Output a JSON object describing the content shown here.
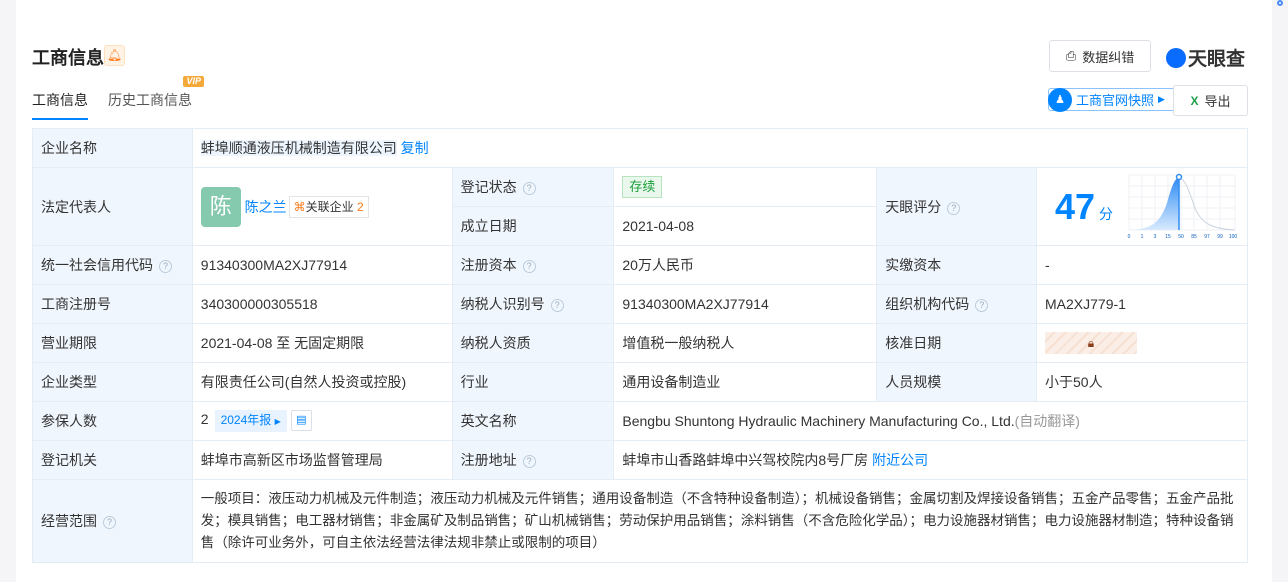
{
  "header": {
    "title": "工商信息",
    "correct_button": "数据纠错",
    "brand": "天眼查",
    "snapshot_button": "工商官网快照",
    "export_button": "导出"
  },
  "tabs": [
    {
      "label": "工商信息",
      "active": true
    },
    {
      "label": "历史工商信息",
      "badge": "VIP"
    }
  ],
  "rows": {
    "company_name": {
      "label": "企业名称",
      "value": "蚌埠顺通液压机械制造有限公司",
      "copy": "复制"
    },
    "legal_rep": {
      "label": "法定代表人",
      "avatar": "陈",
      "name": "陈之兰",
      "related_label": "关联企业",
      "related_count": "2"
    },
    "reg_status": {
      "label": "登记状态",
      "value": "存续",
      "color": "#1a9f3a"
    },
    "founded": {
      "label": "成立日期",
      "value": "2021-04-08"
    },
    "score": {
      "label": "天眼评分",
      "value": "47",
      "unit": "分",
      "ticks": [
        "0",
        "1",
        "3",
        "15",
        "50",
        "85",
        "97",
        "99",
        "100"
      ]
    },
    "credit_code": {
      "label": "统一社会信用代码",
      "value": "91340300MA2XJ77914"
    },
    "reg_capital": {
      "label": "注册资本",
      "value": "20万人民币"
    },
    "paid_capital": {
      "label": "实缴资本",
      "value": "-"
    },
    "reg_no": {
      "label": "工商注册号",
      "value": "340300000305518"
    },
    "tax_id": {
      "label": "纳税人识别号",
      "value": "91340300MA2XJ77914"
    },
    "org_code": {
      "label": "组织机构代码",
      "value": "MA2XJ779-1"
    },
    "term": {
      "label": "营业期限",
      "value": "2021-04-08 至 无固定期限"
    },
    "taxpayer_qual": {
      "label": "纳税人资质",
      "value": "增值税一般纳税人"
    },
    "approval_date": {
      "label": "核准日期"
    },
    "company_type": {
      "label": "企业类型",
      "value": "有限责任公司(自然人投资或控股)"
    },
    "industry": {
      "label": "行业",
      "value": "通用设备制造业"
    },
    "staff_size": {
      "label": "人员规模",
      "value": "小于50人"
    },
    "insured": {
      "label": "参保人数",
      "value": "2",
      "report": "2024年报"
    },
    "english_name": {
      "label": "英文名称",
      "value": "Bengbu Shuntong Hydraulic Machinery Manufacturing Co., Ltd.",
      "note": "(自动翻译)"
    },
    "authority": {
      "label": "登记机关",
      "value": "蚌埠市高新区市场监督管理局"
    },
    "address": {
      "label": "注册地址",
      "value": "蚌埠市山香路蚌埠中兴驾校院内8号厂房",
      "nearby": "附近公司"
    },
    "scope": {
      "label": "经营范围",
      "value": "一般项目：液压动力机械及元件制造；液压动力机械及元件销售；通用设备制造（不含特种设备制造）；机械设备销售；金属切割及焊接设备销售；五金产品零售；五金产品批发；模具销售；电工器材销售；非金属矿及制品销售；矿山机械销售；劳动保护用品销售；涂料销售（不含危险化学品）；电力设施器材销售；电力设施器材制造；特种设备销售（除许可业务外，可自主依法经营法律法规非禁止或限制的项目）"
    }
  }
}
